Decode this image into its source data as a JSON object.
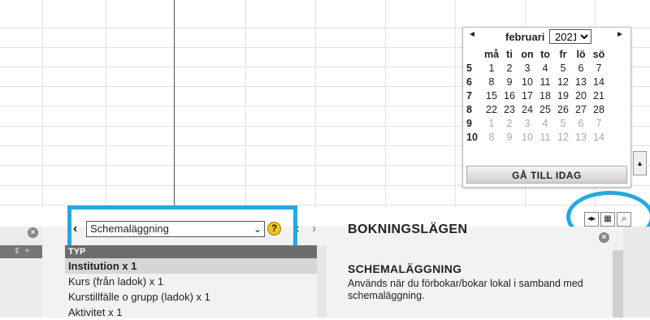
{
  "calendar": {
    "month": "februari",
    "year": "2021",
    "weekdays": [
      "må",
      "ti",
      "on",
      "to",
      "fr",
      "lö",
      "sö"
    ],
    "weeks": [
      {
        "wk": "5",
        "days": [
          "1",
          "2",
          "3",
          "4",
          "5",
          "6",
          "7"
        ],
        "other": [
          false,
          false,
          false,
          false,
          false,
          false,
          false
        ]
      },
      {
        "wk": "6",
        "days": [
          "8",
          "9",
          "10",
          "11",
          "12",
          "13",
          "14"
        ],
        "other": [
          false,
          false,
          false,
          false,
          false,
          false,
          false
        ]
      },
      {
        "wk": "7",
        "days": [
          "15",
          "16",
          "17",
          "18",
          "19",
          "20",
          "21"
        ],
        "other": [
          false,
          false,
          false,
          false,
          false,
          false,
          false
        ]
      },
      {
        "wk": "8",
        "days": [
          "22",
          "23",
          "24",
          "25",
          "26",
          "27",
          "28"
        ],
        "other": [
          false,
          false,
          false,
          false,
          false,
          false,
          false
        ]
      },
      {
        "wk": "9",
        "days": [
          "1",
          "2",
          "3",
          "4",
          "5",
          "6",
          "7"
        ],
        "other": [
          true,
          true,
          true,
          true,
          true,
          true,
          true
        ]
      },
      {
        "wk": "10",
        "days": [
          "8",
          "9",
          "10",
          "11",
          "12",
          "13",
          "14"
        ],
        "other": [
          true,
          true,
          true,
          true,
          true,
          true,
          true
        ]
      }
    ],
    "today_button": "GÅ TILL IDAG"
  },
  "mid_panel": {
    "select_value": "Schemaläggning",
    "help_label": "?",
    "tree_header": "TYP",
    "items": [
      "Institution x 1",
      "Kurs (från ladok) x 1",
      "Kurstillfälle o grupp (ladok) x 1",
      "Aktivitet x 1"
    ]
  },
  "right_panel": {
    "title": "BOKNINGSLÄGEN",
    "subtitle": "SCHEMALÄGGNING",
    "description": "Används när du förbokar/bokar lokal i samband med schemaläggning."
  },
  "colors": {
    "highlight": "#25a9e0"
  }
}
